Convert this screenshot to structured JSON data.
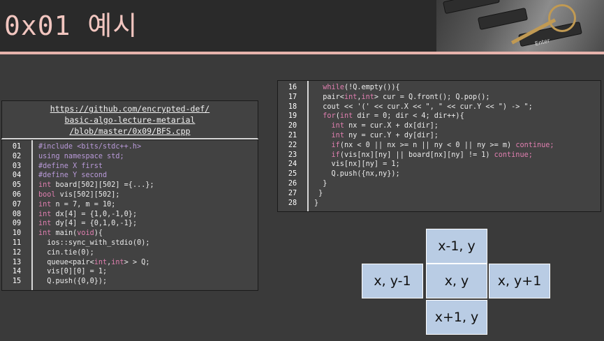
{
  "header": {
    "title": "0x01 예시",
    "photo_key_label": "Enter"
  },
  "source_link": {
    "lines": [
      "https://github.com/encrypted-def/",
      "basic-algo-lecture-metarial",
      "/blob/master/0x09/BFS.cpp"
    ]
  },
  "code_left": [
    {
      "n": "01",
      "segs": [
        {
          "t": "#include <bits/stdc++.h>",
          "c": "pre"
        }
      ]
    },
    {
      "n": "02",
      "segs": [
        {
          "t": "using namespace std;",
          "c": "pre"
        }
      ]
    },
    {
      "n": "03",
      "segs": [
        {
          "t": "#define X first",
          "c": "pre"
        }
      ]
    },
    {
      "n": "04",
      "segs": [
        {
          "t": "#define Y second",
          "c": "pre"
        }
      ]
    },
    {
      "n": "05",
      "segs": [
        {
          "t": "int",
          "c": "kw"
        },
        {
          "t": " board[502][502] ={...};"
        }
      ]
    },
    {
      "n": "06",
      "segs": [
        {
          "t": "bool",
          "c": "kw"
        },
        {
          "t": " vis[502][502];"
        }
      ]
    },
    {
      "n": "07",
      "segs": [
        {
          "t": "int",
          "c": "kw"
        },
        {
          "t": " n = 7, m = 10;"
        }
      ]
    },
    {
      "n": "08",
      "segs": [
        {
          "t": "int",
          "c": "kw"
        },
        {
          "t": " dx[4] = {1,0,-1,0};"
        }
      ]
    },
    {
      "n": "09",
      "segs": [
        {
          "t": "int",
          "c": "kw"
        },
        {
          "t": " dy[4] = {0,1,0,-1};"
        }
      ]
    },
    {
      "n": "10",
      "segs": [
        {
          "t": "int",
          "c": "kw"
        },
        {
          "t": " main("
        },
        {
          "t": "void",
          "c": "kw"
        },
        {
          "t": "){"
        }
      ]
    },
    {
      "n": "11",
      "segs": [
        {
          "t": "  ios::sync_with_stdio(0);"
        }
      ]
    },
    {
      "n": "12",
      "segs": [
        {
          "t": "  cin.tie(0);"
        }
      ]
    },
    {
      "n": "13",
      "segs": [
        {
          "t": "  queue<pair<"
        },
        {
          "t": "int",
          "c": "kw"
        },
        {
          "t": ","
        },
        {
          "t": "int",
          "c": "kw"
        },
        {
          "t": "> > Q;"
        }
      ]
    },
    {
      "n": "14",
      "segs": [
        {
          "t": "  vis[0][0] = 1;"
        }
      ]
    },
    {
      "n": "15",
      "segs": [
        {
          "t": "  Q.push({0,0});"
        }
      ]
    }
  ],
  "code_right": [
    {
      "n": "16",
      "segs": [
        {
          "t": "  "
        },
        {
          "t": "while",
          "c": "kw"
        },
        {
          "t": "(!Q.empty()){"
        }
      ]
    },
    {
      "n": "17",
      "segs": [
        {
          "t": "  pair<"
        },
        {
          "t": "int",
          "c": "kw"
        },
        {
          "t": ","
        },
        {
          "t": "int",
          "c": "kw"
        },
        {
          "t": "> cur = Q.front(); Q.pop();"
        }
      ]
    },
    {
      "n": "18",
      "segs": [
        {
          "t": "  cout << '(' << cur.X << \", \" << cur.Y << \") -> \";"
        }
      ]
    },
    {
      "n": "19",
      "segs": [
        {
          "t": "  "
        },
        {
          "t": "for",
          "c": "kw"
        },
        {
          "t": "("
        },
        {
          "t": "int",
          "c": "kw"
        },
        {
          "t": " dir = 0; dir < 4; dir++){"
        }
      ]
    },
    {
      "n": "20",
      "segs": [
        {
          "t": "    "
        },
        {
          "t": "int",
          "c": "kw"
        },
        {
          "t": " nx = cur.X + dx[dir];"
        }
      ]
    },
    {
      "n": "21",
      "segs": [
        {
          "t": "    "
        },
        {
          "t": "int",
          "c": "kw"
        },
        {
          "t": " ny = cur.Y + dy[dir];"
        }
      ]
    },
    {
      "n": "22",
      "segs": [
        {
          "t": "    "
        },
        {
          "t": "if",
          "c": "kw"
        },
        {
          "t": "(nx < 0 || nx >= n || ny < 0 || ny >= m) "
        },
        {
          "t": "continue;",
          "c": "kw"
        }
      ]
    },
    {
      "n": "23",
      "segs": [
        {
          "t": "    "
        },
        {
          "t": "if",
          "c": "kw"
        },
        {
          "t": "(vis[nx][ny] || board[nx][ny] != 1) "
        },
        {
          "t": "continue;",
          "c": "kw"
        }
      ]
    },
    {
      "n": "24",
      "segs": [
        {
          "t": "    vis[nx][ny] = 1;"
        }
      ]
    },
    {
      "n": "25",
      "segs": [
        {
          "t": "    Q.push({nx,ny});"
        }
      ]
    },
    {
      "n": "26",
      "segs": [
        {
          "t": "  }"
        }
      ]
    },
    {
      "n": "27",
      "segs": [
        {
          "t": " }"
        }
      ]
    },
    {
      "n": "28",
      "segs": [
        {
          "t": "}"
        }
      ]
    }
  ],
  "neighbor_grid": {
    "top": "x-1, y",
    "left": "x, y-1",
    "center": "x, y",
    "right": "x, y+1",
    "bottom": "x+1, y"
  },
  "colors": {
    "title": "#f2c6c0",
    "accent_rule": "#e6b3ac",
    "keyword": "#e07fb0",
    "preprocessor": "#b99ad9",
    "grid_cell": "#b9cce4"
  }
}
